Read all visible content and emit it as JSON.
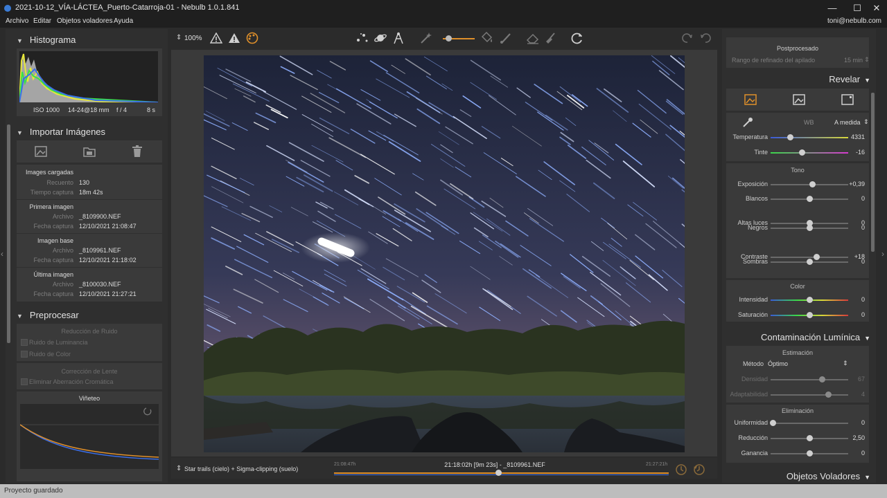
{
  "window": {
    "title": "2021-10-12_VÍA-LÁCTEA_Puerto-Catarroja-01 - Nebulb 1.0.1.841",
    "minimize": "—",
    "maximize": "☐",
    "close": "✕"
  },
  "menu": {
    "items": [
      "Archivo",
      "Editar",
      "Objetos voladores",
      "Ayuda"
    ],
    "user": "toni@nebulb.com"
  },
  "status": {
    "text": "Proyecto guardado"
  },
  "colors": {
    "accent": "#e0902a",
    "knob": "#cfcfcf"
  },
  "histogram": {
    "title": "Histograma",
    "iso": "ISO 1000",
    "lens": "14-24@18 mm",
    "aperture": "f / 4",
    "exposure": "8 s"
  },
  "import": {
    "title": "Importar Imágenes",
    "icons": [
      "add-image-icon",
      "folder-icon",
      "trash-icon"
    ],
    "loaded": {
      "title": "Images cargadas",
      "count_label": "Recuento",
      "count": "130",
      "time_label": "Tiempo captura",
      "time": "18m 42s"
    },
    "first": {
      "title": "Primera imagen",
      "file_label": "Archivo",
      "file": "_8109900.NEF",
      "date_label": "Fecha captura",
      "date": "12/10/2021 21:08:47"
    },
    "base": {
      "title": "Imagen base",
      "file_label": "Archivo",
      "file": "_8109961.NEF",
      "date_label": "Fecha captura",
      "date": "12/10/2021 21:18:02"
    },
    "last": {
      "title": "Última imagen",
      "file_label": "Archivo",
      "file": "_8100030.NEF",
      "date_label": "Fecha captura",
      "date": "12/10/2021 21:27:21"
    }
  },
  "preprocess": {
    "title": "Preprocesar",
    "noise_title": "Reducción de Ruido",
    "noise_luma": "Ruido de Luminancia",
    "noise_color": "Ruido de Color",
    "lens_title": "Corrección de Lente",
    "chromatic": "Eliminar Aberración Cromática",
    "vignette_title": "Viñeteo"
  },
  "toolbar": {
    "zoom": "100%"
  },
  "timeline": {
    "stack_mode": "Star trails (cielo) + Sigma-clipping (suelo)",
    "start": "21:08:47h",
    "current": "21:18:02h [9m 23s] - _8109961.NEF",
    "end": "21:27:21h",
    "position": 0.49
  },
  "right": {
    "post_title": "Postprocesado",
    "refine_label": "Rango de refinado del apilado",
    "refine_value": "15 min",
    "reveal_title": "Revelar",
    "wb_label": "WB",
    "wb_value": "A medida",
    "tone_title": "Tono",
    "color_title": "Color",
    "sliders_wb": [
      {
        "label": "Temperatura",
        "value": "4331",
        "pos": 0.25
      },
      {
        "label": "Tinte",
        "value": "-16",
        "pos": 0.4
      }
    ],
    "sliders_tone": [
      {
        "label": "Exposición",
        "value": "+0,39",
        "pos": 0.54
      },
      {
        "label": "Blancos",
        "value": "0",
        "pos": 0.5
      },
      {
        "label": "Altas luces",
        "value": "0",
        "pos": 0.5
      },
      {
        "label": "Negros",
        "value": "0",
        "pos": 0.5
      },
      {
        "label": "Sombras",
        "value": "0",
        "pos": 0.5
      },
      {
        "label": "Contraste",
        "value": "+18",
        "pos": 0.59
      }
    ],
    "sliders_color": [
      {
        "label": "Intensidad",
        "value": "0",
        "pos": 0.5
      },
      {
        "label": "Saturación",
        "value": "0",
        "pos": 0.5
      }
    ],
    "lp_title": "Contaminación Lumínica",
    "estimation_title": "Estimación",
    "method_label": "Método",
    "method_value": "Óptimo",
    "sliders_est": [
      {
        "label": "Densidad",
        "value": "67",
        "pos": 0.66
      },
      {
        "label": "Adaptabilidad",
        "value": "4",
        "pos": 0.74
      }
    ],
    "elimination_title": "Eliminación",
    "sliders_elim": [
      {
        "label": "Uniformidad",
        "value": "0",
        "pos": 0.03
      },
      {
        "label": "Reducción",
        "value": "2,50",
        "pos": 0.5
      },
      {
        "label": "Ganancia",
        "value": "0",
        "pos": 0.5
      }
    ],
    "flying_title": "Objetos Voladores"
  }
}
